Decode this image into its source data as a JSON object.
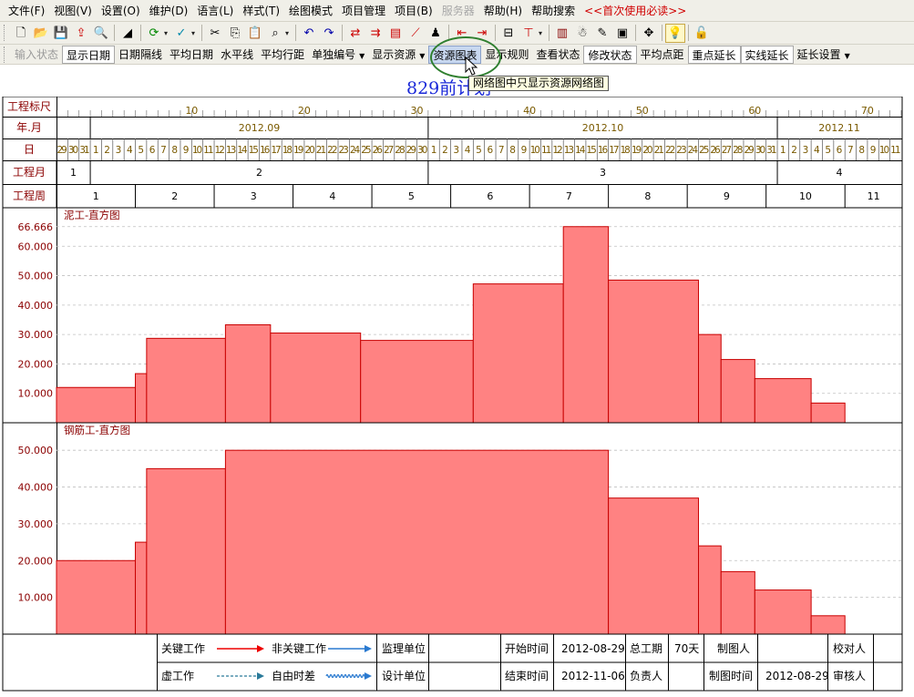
{
  "menu": [
    {
      "label": "文件(F)"
    },
    {
      "label": "视图(V)"
    },
    {
      "label": "设置(O)"
    },
    {
      "label": "维护(D)"
    },
    {
      "label": "语言(L)"
    },
    {
      "label": "样式(T)"
    },
    {
      "label": "绘图模式"
    },
    {
      "label": "项目管理"
    },
    {
      "label": "项目(B)"
    },
    {
      "label": "服务器",
      "disabled": true
    },
    {
      "label": "帮助(H)"
    },
    {
      "label": "帮助搜索"
    },
    {
      "label": "<<首次使用必读>>",
      "red": true
    }
  ],
  "toolbar_icons": [
    "new-file-icon",
    "open-folder-icon",
    "save-icon",
    "export-icon",
    "print-preview-icon",
    "fill-triangle-icon",
    "refresh-icon",
    "check-spell-icon",
    "cut-icon",
    "copy-icon",
    "paste-icon",
    "find-binoculars-icon",
    "undo-icon",
    "redo-icon",
    "network-icon",
    "link-icon",
    "bar-chart-icon",
    "line-chart-icon",
    "resource-icon",
    "move-left-icon",
    "move-right-icon",
    "split-icon",
    "milestone-icon",
    "books-icon",
    "person-icon",
    "edit-icon",
    "display-icon",
    "pan-icon",
    "lightbulb-icon",
    "unlock-icon"
  ],
  "toolbar2": [
    {
      "label": "输入状态",
      "disabled": true
    },
    {
      "label": "显示日期",
      "boxed": true
    },
    {
      "label": "日期隔线"
    },
    {
      "label": "平均日期"
    },
    {
      "label": "水平线"
    },
    {
      "label": "平均行距"
    },
    {
      "label": "单独编号",
      "dropdown": true
    },
    {
      "label": "显示资源",
      "dropdown": true
    },
    {
      "label": "资源图表",
      "hovered": true
    },
    {
      "label": "显示规则"
    },
    {
      "label": "查看状态"
    },
    {
      "label": "修改状态",
      "boxed": true
    },
    {
      "label": "平均点距"
    },
    {
      "label": "重点延长",
      "boxed": true
    },
    {
      "label": "实线延长",
      "boxed": true
    },
    {
      "label": "延长设置",
      "dropdown": true
    }
  ],
  "canvas_title": "829前计划",
  "tooltip": "网络图中只显示资源网络图",
  "rows": {
    "scale": "工程标尺",
    "yearmonth": "年.月",
    "day": "日",
    "proj_month": "工程月",
    "proj_week": "工程周"
  },
  "scale_ticks": [
    10,
    20,
    30,
    40,
    50,
    60,
    70
  ],
  "months": [
    {
      "label": "2012.09",
      "start": 3,
      "end": 33
    },
    {
      "label": "2012.10",
      "start": 33,
      "end": 64
    },
    {
      "label": "2012.11",
      "start": 64,
      "end": 75
    }
  ],
  "days_start": [
    29,
    30,
    31
  ],
  "proj_months": [
    {
      "label": "1",
      "start": 0,
      "end": 3
    },
    {
      "label": "2",
      "start": 3,
      "end": 33
    },
    {
      "label": "3",
      "start": 33,
      "end": 64
    },
    {
      "label": "4",
      "start": 64,
      "end": 75
    }
  ],
  "weeks": [
    "1",
    "2",
    "3",
    "4",
    "5",
    "6",
    "7",
    "8",
    "9",
    "10",
    "11"
  ],
  "chart_data": [
    {
      "type": "bar",
      "title": "泥工-直方图",
      "xlabel": "",
      "ylabel": "",
      "yticks": [
        "66.666",
        "60.000",
        "50.000",
        "40.000",
        "30.000",
        "20.000",
        "10.000"
      ],
      "ylim": [
        0,
        70
      ],
      "segments": [
        {
          "from": 0,
          "to": 7,
          "value": 12
        },
        {
          "from": 7,
          "to": 8,
          "value": 16.7
        },
        {
          "from": 8,
          "to": 15,
          "value": 28.7
        },
        {
          "from": 15,
          "to": 19,
          "value": 33.3
        },
        {
          "from": 19,
          "to": 27,
          "value": 30.5
        },
        {
          "from": 27,
          "to": 37,
          "value": 28
        },
        {
          "from": 37,
          "to": 45,
          "value": 47.2
        },
        {
          "from": 45,
          "to": 49,
          "value": 66.666
        },
        {
          "from": 49,
          "to": 57,
          "value": 48.5
        },
        {
          "from": 57,
          "to": 59,
          "value": 30
        },
        {
          "from": 59,
          "to": 62,
          "value": 21.5
        },
        {
          "from": 62,
          "to": 67,
          "value": 15
        },
        {
          "from": 67,
          "to": 70,
          "value": 6.7
        }
      ]
    },
    {
      "type": "bar",
      "title": "钢筋工-直方图",
      "xlabel": "",
      "ylabel": "",
      "yticks": [
        "50.000",
        "40.000",
        "30.000",
        "20.000",
        "10.000"
      ],
      "ylim": [
        0,
        55
      ],
      "segments": [
        {
          "from": 0,
          "to": 7,
          "value": 20
        },
        {
          "from": 7,
          "to": 8,
          "value": 25
        },
        {
          "from": 8,
          "to": 15,
          "value": 45
        },
        {
          "from": 15,
          "to": 49,
          "value": 50
        },
        {
          "from": 49,
          "to": 57,
          "value": 37
        },
        {
          "from": 57,
          "to": 59,
          "value": 24
        },
        {
          "from": 59,
          "to": 62,
          "value": 17
        },
        {
          "from": 62,
          "to": 67,
          "value": 12
        },
        {
          "from": 67,
          "to": 70,
          "value": 5
        }
      ]
    }
  ],
  "colors": {
    "bar_fill": "#ff8282",
    "bar_stroke": "#c80000",
    "axis_text": "#000000",
    "header_text": "#7a5a00",
    "title_text": "#8b0000",
    "grid": "#c0c0c0"
  },
  "legend": {
    "critical": "关键工作",
    "noncritical": "非关键工作",
    "dummy": "虚工作",
    "freefloat": "自由时差",
    "supervisor_label": "监理单位",
    "supervisor_value": "",
    "design_label": "设计单位",
    "design_value": "",
    "start_label": "开始时间",
    "start_value": "2012-08-29",
    "end_label": "结束时间",
    "end_value": "2012-11-06",
    "duration_label": "总工期",
    "duration_value": "70天",
    "owner_label": "负责人",
    "owner_value": "",
    "drafter_label": "制图人",
    "drafter_value": "",
    "drawtime_label": "制图时间",
    "drawtime_value": "2012-08-29",
    "checker_label": "校对人",
    "checker_value": "",
    "reviewer_label": "审核人",
    "reviewer_value": ""
  }
}
